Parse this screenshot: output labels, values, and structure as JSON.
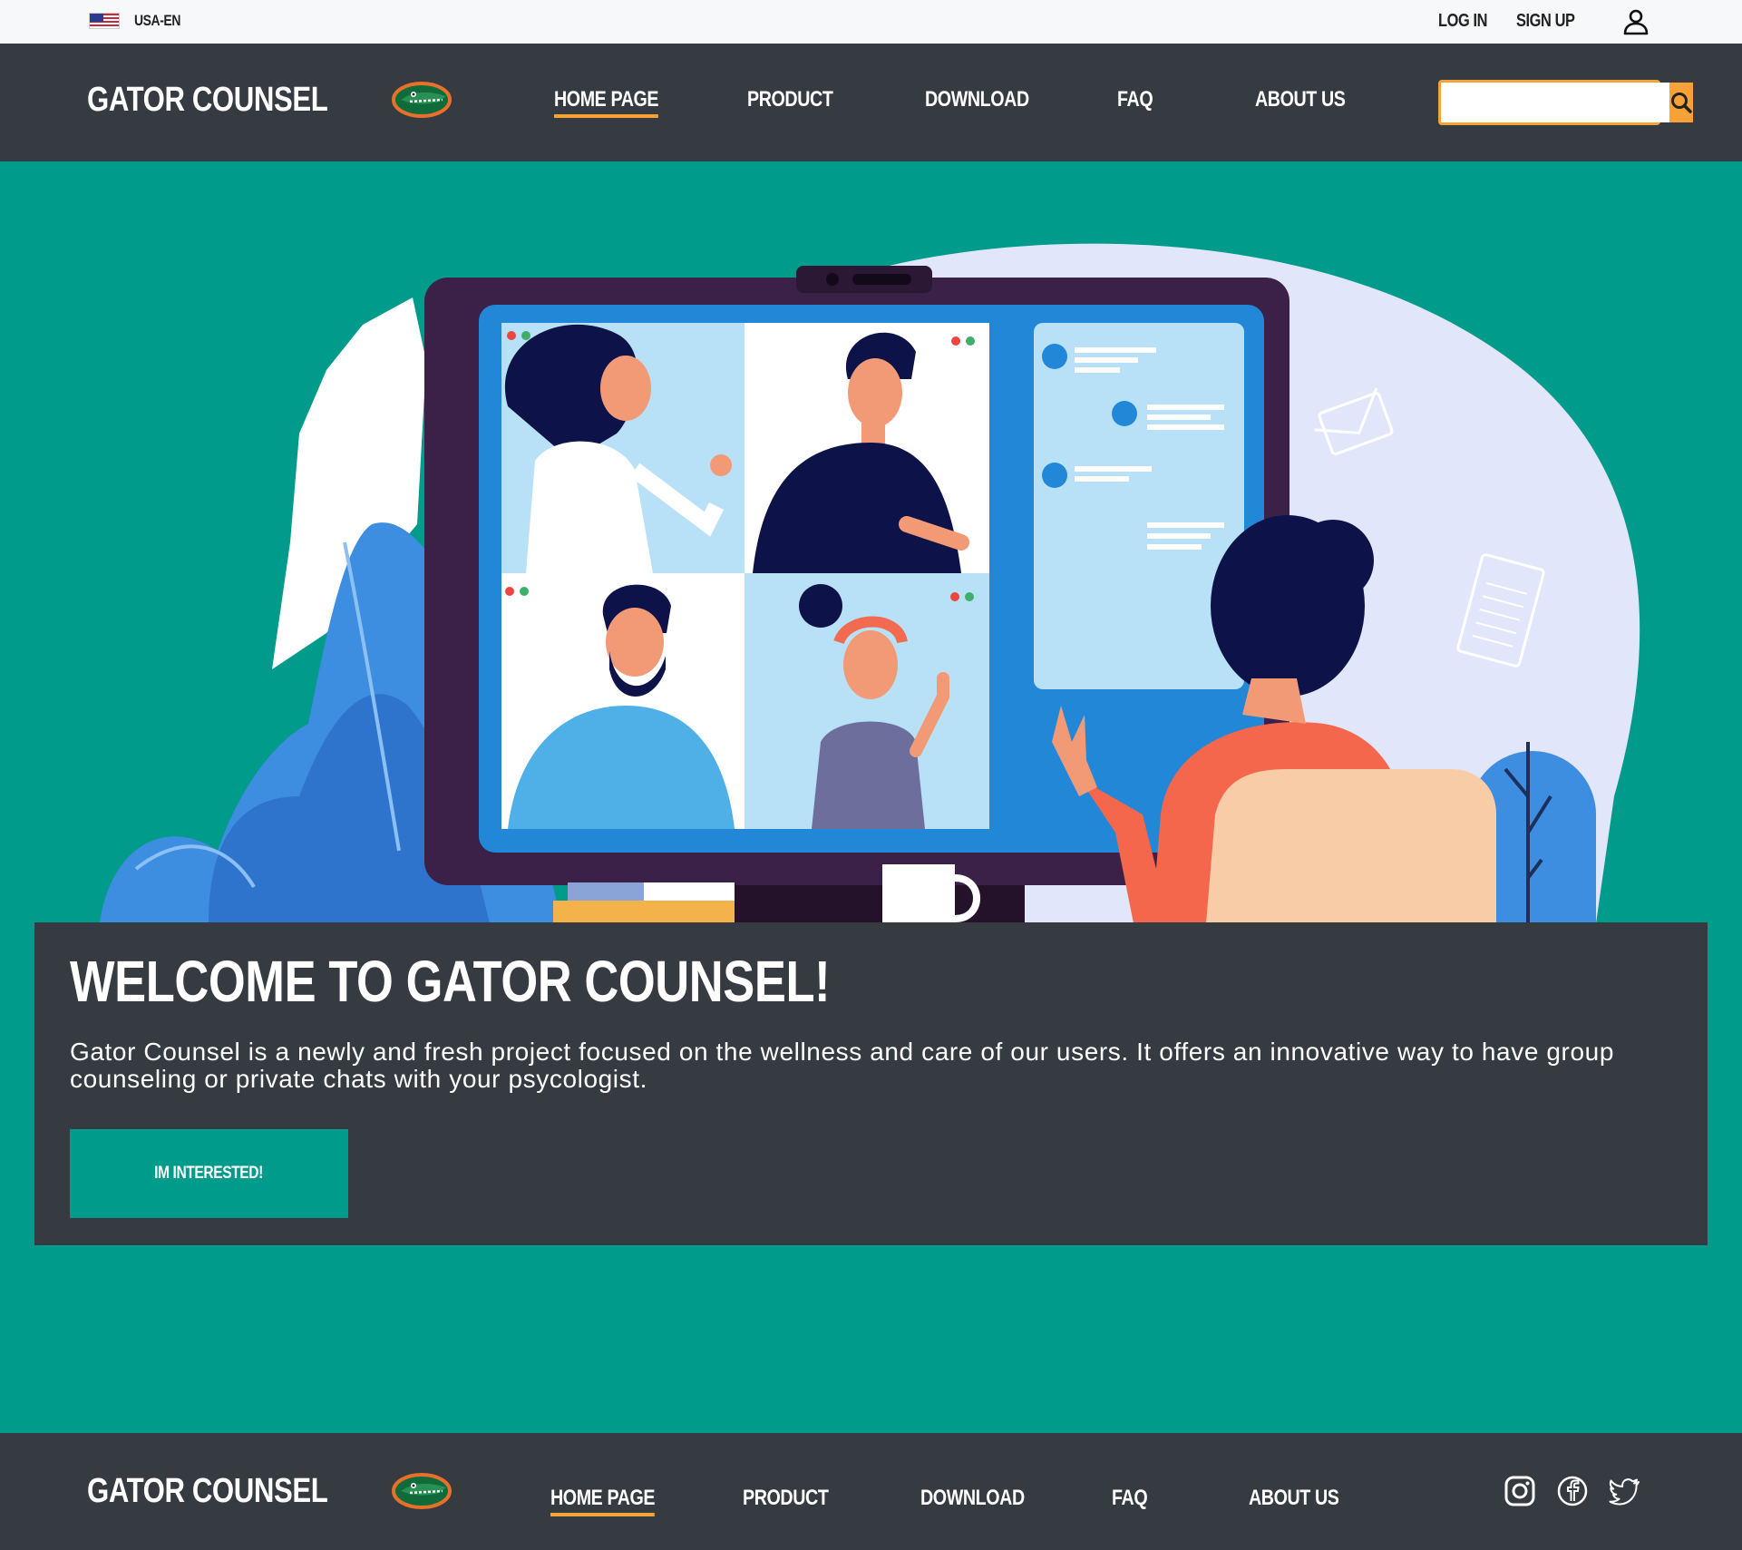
{
  "topbar": {
    "locale": "USA-EN",
    "login_label": "LOG IN",
    "signup_label": "SIGN UP"
  },
  "brand": {
    "name": "GATOR COUNSEL"
  },
  "nav": {
    "items": [
      {
        "label": "HOME PAGE",
        "active": true
      },
      {
        "label": "PRODUCT",
        "active": false
      },
      {
        "label": "DOWNLOAD",
        "active": false
      },
      {
        "label": "FAQ",
        "active": false
      },
      {
        "label": "ABOUT US",
        "active": false
      }
    ]
  },
  "search": {
    "value": "",
    "placeholder": ""
  },
  "hero": {
    "title": "WELCOME TO GATOR COUNSEL!",
    "text": "Gator Counsel is a newly and fresh project focused on the wellness and care of our users. It offers an innovative way to have group counseling or private chats with your psycologist.",
    "cta_label": "IM INTERESTED!"
  },
  "footer": {
    "social_icons": [
      "instagram-icon",
      "facebook-icon",
      "twitter-icon"
    ]
  },
  "colors": {
    "teal": "#009b8a",
    "dark": "#363a41",
    "accent": "#f7a238",
    "topbar": "#f7f8fa"
  }
}
